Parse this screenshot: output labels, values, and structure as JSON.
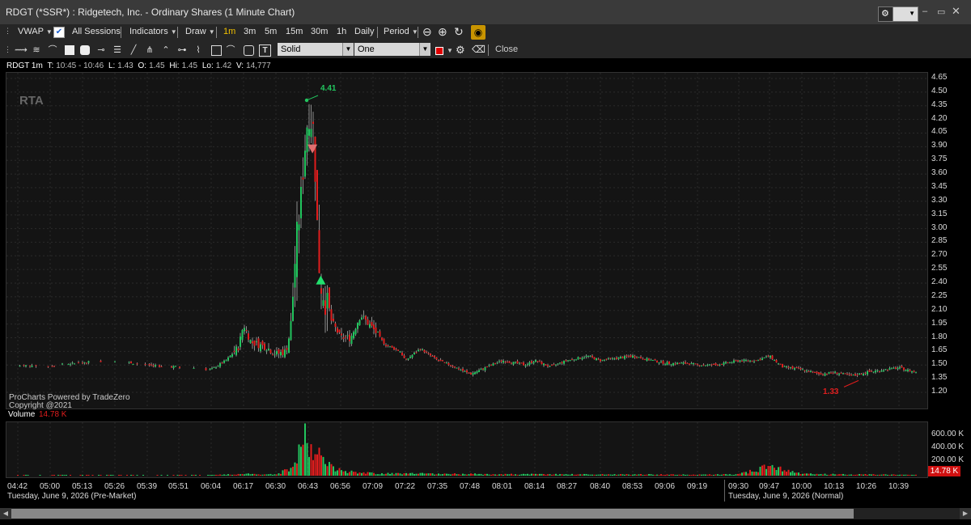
{
  "window": {
    "title": "RDGT (*SSR*) : Ridgetech, Inc. - Ordinary Shares (1 Minute Chart)"
  },
  "toolbar": {
    "vwap": "VWAP",
    "all_sessions": "All Sessions",
    "indicators": "Indicators",
    "draw": "Draw",
    "intervals": [
      "1m",
      "3m",
      "5m",
      "15m",
      "30m",
      "1h",
      "Daily"
    ],
    "active_interval": "1m",
    "period": "Period"
  },
  "drawbar": {
    "line_style": "Solid",
    "line_count": "One",
    "close": "Close",
    "color": "#e00000"
  },
  "info": {
    "symbol": "RDGT 1m",
    "t_label": "T:",
    "t_value": "10:45 - 10:46",
    "l_label": "L:",
    "l_value": "1.43",
    "o_label": "O:",
    "o_value": "1.45",
    "hi_label": "Hi:",
    "hi_value": "1.45",
    "lo_label": "Lo:",
    "lo_value": "1.42",
    "v_label": "V:",
    "v_value": "14,777"
  },
  "chart_overlay": {
    "watermark": "RTA",
    "brand_line1": "ProCharts Powered by TradeZero",
    "brand_line2": "Copyright @2021",
    "high_label": "4.41",
    "low_label": "1.33"
  },
  "volume": {
    "label": "Volume",
    "value": "14.78 K",
    "current_badge": "14.78 K"
  },
  "volume_axis": {
    "ticks": [
      "600.00 K",
      "400.00 K",
      "200.00 K"
    ]
  },
  "y_axis": {
    "ticks": [
      "4.65",
      "4.50",
      "4.35",
      "4.20",
      "4.05",
      "3.90",
      "3.75",
      "3.60",
      "3.45",
      "3.30",
      "3.15",
      "3.00",
      "2.85",
      "2.70",
      "2.55",
      "2.40",
      "2.25",
      "2.10",
      "1.95",
      "1.80",
      "1.65",
      "1.50",
      "1.35",
      "1.20"
    ]
  },
  "x_axis": {
    "ticks": [
      "04:42",
      "05:00",
      "05:13",
      "05:26",
      "05:39",
      "05:51",
      "06:04",
      "06:17",
      "06:30",
      "06:43",
      "06:56",
      "07:09",
      "07:22",
      "07:35",
      "07:48",
      "08:01",
      "08:14",
      "08:27",
      "08:40",
      "08:53",
      "09:06",
      "09:19",
      "09:30",
      "09:47",
      "10:00",
      "10:13",
      "10:26",
      "10:39"
    ],
    "session_premarket": "Tuesday, June 9, 2026 (Pre-Market)",
    "session_normal": "Tuesday, June 9, 2026 (Normal)"
  },
  "colors": {
    "up": "#22c55e",
    "down": "#e11d1d",
    "accent_interval": "#f0c000",
    "badge_bg": "#d01010"
  },
  "chart_data": {
    "type": "candlestick",
    "title": "RDGT (*SSR*) : Ridgetech, Inc. - Ordinary Shares (1 Minute Chart)",
    "ylim": [
      1.2,
      4.65
    ],
    "high_marker": 4.41,
    "low_marker": 1.33,
    "price_path": [
      [
        "04:42",
        1.5
      ],
      [
        "05:00",
        1.49
      ],
      [
        "05:13",
        1.53
      ],
      [
        "05:26",
        1.55
      ],
      [
        "05:39",
        1.5
      ],
      [
        "05:51",
        1.48
      ],
      [
        "06:04",
        1.45
      ],
      [
        "06:10",
        1.55
      ],
      [
        "06:15",
        1.7
      ],
      [
        "06:17",
        1.95
      ],
      [
        "06:20",
        1.75
      ],
      [
        "06:26",
        1.7
      ],
      [
        "06:30",
        1.62
      ],
      [
        "06:34",
        1.65
      ],
      [
        "06:36",
        1.9
      ],
      [
        "06:38",
        2.8
      ],
      [
        "06:40",
        3.3
      ],
      [
        "06:41",
        3.7
      ],
      [
        "06:42",
        4.0
      ],
      [
        "06:43",
        4.3
      ],
      [
        "06:45",
        4.1
      ],
      [
        "06:46",
        3.5
      ],
      [
        "06:47",
        2.7
      ],
      [
        "06:48",
        2.4
      ],
      [
        "06:50",
        2.2
      ],
      [
        "06:52",
        2.0
      ],
      [
        "06:54",
        1.9
      ],
      [
        "06:56",
        1.8
      ],
      [
        "07:00",
        1.8
      ],
      [
        "07:04",
        2.05
      ],
      [
        "07:09",
        1.9
      ],
      [
        "07:14",
        1.72
      ],
      [
        "07:20",
        1.65
      ],
      [
        "07:22",
        1.55
      ],
      [
        "07:28",
        1.68
      ],
      [
        "07:35",
        1.55
      ],
      [
        "07:40",
        1.5
      ],
      [
        "07:48",
        1.4
      ],
      [
        "07:55",
        1.48
      ],
      [
        "08:01",
        1.55
      ],
      [
        "08:10",
        1.5
      ],
      [
        "08:14",
        1.55
      ],
      [
        "08:20",
        1.48
      ],
      [
        "08:27",
        1.55
      ],
      [
        "08:35",
        1.6
      ],
      [
        "08:40",
        1.55
      ],
      [
        "08:53",
        1.6
      ],
      [
        "09:06",
        1.52
      ],
      [
        "09:15",
        1.52
      ],
      [
        "09:19",
        1.5
      ],
      [
        "09:24",
        1.5
      ],
      [
        "09:30",
        1.55
      ],
      [
        "09:40",
        1.55
      ],
      [
        "09:47",
        1.6
      ],
      [
        "09:52",
        1.48
      ],
      [
        "10:00",
        1.45
      ],
      [
        "10:07",
        1.4
      ],
      [
        "10:13",
        1.42
      ],
      [
        "10:20",
        1.38
      ],
      [
        "10:26",
        1.42
      ],
      [
        "10:33",
        1.45
      ],
      [
        "10:39",
        1.47
      ],
      [
        "10:46",
        1.42
      ]
    ],
    "volume_path": [
      [
        "04:42",
        5
      ],
      [
        "06:04",
        8
      ],
      [
        "06:17",
        30
      ],
      [
        "06:30",
        20
      ],
      [
        "06:36",
        120
      ],
      [
        "06:38",
        350
      ],
      [
        "06:40",
        500
      ],
      [
        "06:41",
        650
      ],
      [
        "06:42",
        780
      ],
      [
        "06:43",
        600
      ],
      [
        "06:45",
        480
      ],
      [
        "06:47",
        380
      ],
      [
        "06:50",
        220
      ],
      [
        "06:56",
        90
      ],
      [
        "07:09",
        40
      ],
      [
        "08:01",
        25
      ],
      [
        "09:06",
        20
      ],
      [
        "09:19",
        15
      ],
      [
        "09:30",
        25
      ],
      [
        "09:47",
        160
      ],
      [
        "10:00",
        30
      ],
      [
        "10:26",
        20
      ],
      [
        "10:46",
        15
      ]
    ]
  }
}
